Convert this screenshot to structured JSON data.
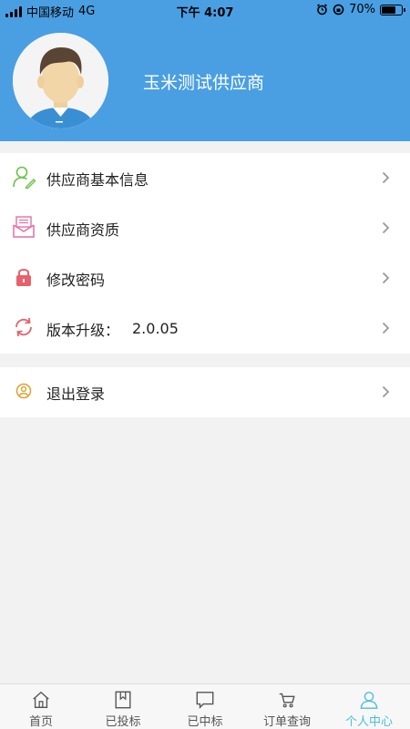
{
  "status_bar": {
    "carrier": "中国移动",
    "network": "4G",
    "time": "下午 4:07",
    "battery": "70%",
    "battery_level": 0.7
  },
  "profile": {
    "name": "玉米测试供应商",
    "avatar_icon": "default-avatar-icon"
  },
  "menu": [
    {
      "label": "供应商基本信息",
      "icon": "user-edit-icon",
      "color": "#6cc24a"
    },
    {
      "label": "供应商资质",
      "icon": "envelope-icon",
      "color": "#e56fa4"
    },
    {
      "label": "修改密码",
      "icon": "lock-icon",
      "color": "#e8606a"
    },
    {
      "label": "版本升级：",
      "value": "2.0.05",
      "icon": "refresh-icon",
      "color": "#e8606a"
    }
  ],
  "logout": {
    "label": "退出登录",
    "icon": "user-circle-icon",
    "color": "#e0a030"
  },
  "tabs": [
    {
      "label": "首页",
      "icon": "home-icon",
      "active": false
    },
    {
      "label": "已投标",
      "icon": "bookmark-icon",
      "active": false
    },
    {
      "label": "已中标",
      "icon": "chat-icon",
      "active": false
    },
    {
      "label": "订单查询",
      "icon": "cart-icon",
      "active": false
    },
    {
      "label": "个人中心",
      "icon": "person-icon",
      "active": true
    }
  ],
  "colors": {
    "header": "#4a9fe3",
    "active_tab": "#4cbfd8",
    "background": "#f2f2f2"
  }
}
